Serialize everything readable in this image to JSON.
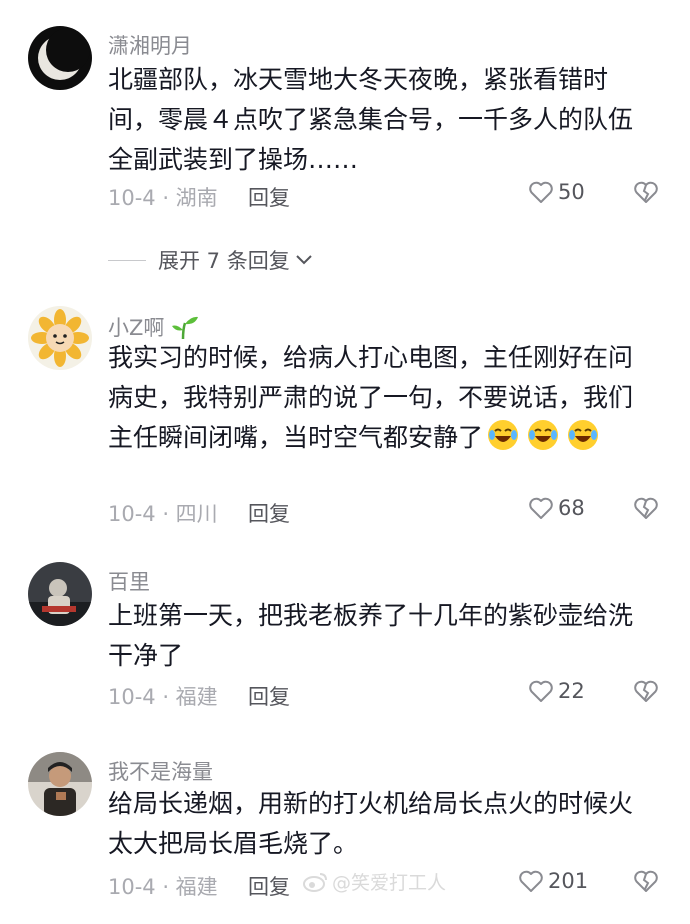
{
  "comments": [
    {
      "user": "潇湘明月",
      "text": "北疆部队，冰天雪地大冬天夜晚，紧张看错时间，零晨４点吹了紧急集合号，一千多人的队伍全副武装到了操场……",
      "date_location": "10-4 · 湖南",
      "reply_label": "回复",
      "likes": "50",
      "expand_label": "展开 7 条回复"
    },
    {
      "user": "小Z啊",
      "text": "我实习的时候，给病人打心电图，主任刚好在问病史，我特别严肃的说了一句，不要说话，我们主任瞬间闭嘴，当时空气都安静了",
      "date_location": "10-4 · 四川",
      "reply_label": "回复",
      "likes": "68"
    },
    {
      "user": "百里",
      "text": "上班第一天，把我老板养了十几年的紫砂壶给洗干净了",
      "date_location": "10-4 · 福建",
      "reply_label": "回复",
      "likes": "22"
    },
    {
      "user": "我不是海量",
      "text": "给局长递烟，用新的打火机给局长点火的时候火太大把局长眉毛烧了。",
      "date_location": "10-4 · 福建",
      "reply_label": "回复",
      "likes": "201"
    }
  ],
  "icons": {
    "like": "heart-outline-icon",
    "dislike": "broken-heart-icon",
    "chevron": "chevron-down-icon",
    "emoji": "crying-laughing-emoji-icon",
    "sprout": "sprout-icon",
    "weibo": "weibo-logo-icon"
  },
  "watermark": "@笑爱打工人",
  "colors": {
    "username": "#8a8b91",
    "text": "#161823",
    "meta": "#a9aab0"
  }
}
